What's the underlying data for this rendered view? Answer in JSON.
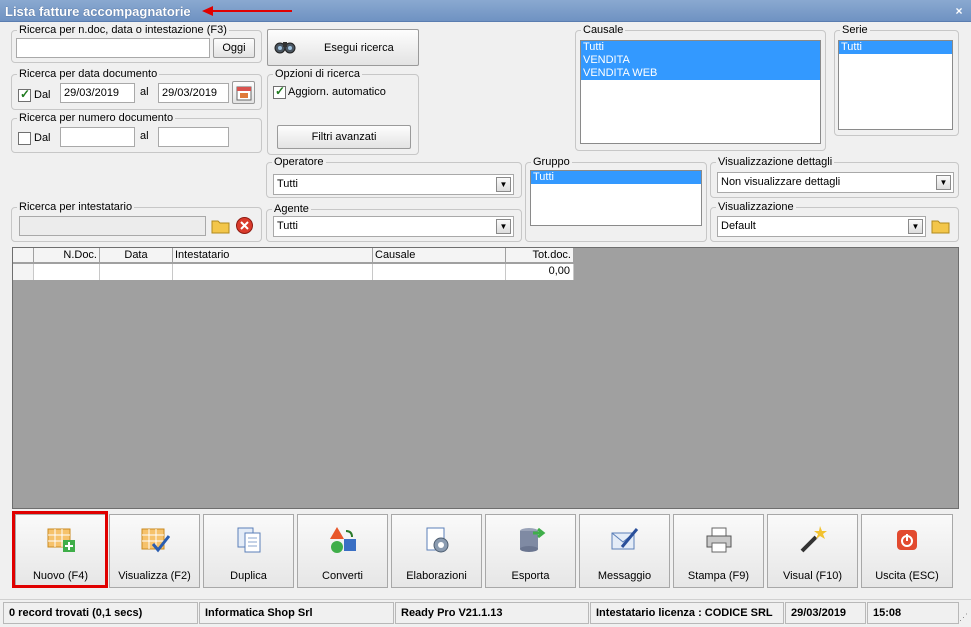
{
  "window": {
    "title": "Lista fatture accompagnatorie",
    "close": "×"
  },
  "search": {
    "legend": "Ricerca per n.doc, data o intestazione (F3)",
    "value": "",
    "today_button": "Oggi",
    "run_button": "Esegui ricerca"
  },
  "date_search": {
    "legend": "Ricerca per data documento",
    "from_label": "Dal",
    "from_checked": true,
    "from_value": "29/03/2019",
    "to_label": "al",
    "to_value": "29/03/2019"
  },
  "number_search": {
    "legend": "Ricerca per numero documento",
    "from_label": "Dal",
    "from_checked": false,
    "from_value": "",
    "to_label": "al",
    "to_value": ""
  },
  "options": {
    "legend": "Opzioni di ricerca",
    "auto_update_label": "Aggiorn. automatico",
    "auto_update_checked": true,
    "advanced_button": "Filtri avanzati"
  },
  "causale": {
    "legend": "Causale",
    "items": [
      "Tutti",
      "VENDITA",
      "VENDITA WEB"
    ]
  },
  "serie": {
    "legend": "Serie",
    "items": [
      "Tutti"
    ]
  },
  "operatore": {
    "legend": "Operatore",
    "value": "Tutti"
  },
  "agente": {
    "legend": "Agente",
    "value": "Tutti"
  },
  "gruppo": {
    "legend": "Gruppo",
    "items": [
      "Tutti"
    ]
  },
  "dettagli": {
    "legend": "Visualizzazione dettagli",
    "value": "Non visualizzare dettagli"
  },
  "visualizzazione": {
    "legend": "Visualizzazione",
    "value": "Default"
  },
  "intestatario": {
    "legend": "Ricerca per intestatario",
    "value": ""
  },
  "grid": {
    "columns": [
      "N.Doc.",
      "Data",
      "Intestatario",
      "Causale",
      "Tot.doc."
    ],
    "rows": [
      [
        "",
        "",
        "",
        "",
        "0,00"
      ]
    ]
  },
  "toolbar": {
    "buttons": [
      {
        "label": "Nuovo (F4)",
        "icon": "new-grid-icon"
      },
      {
        "label": "Visualizza (F2)",
        "icon": "view-grid-icon"
      },
      {
        "label": "Duplica",
        "icon": "duplicate-icon"
      },
      {
        "label": "Converti",
        "icon": "convert-icon"
      },
      {
        "label": "Elaborazioni",
        "icon": "process-icon"
      },
      {
        "label": "Esporta",
        "icon": "export-icon"
      },
      {
        "label": "Messaggio",
        "icon": "message-icon"
      },
      {
        "label": "Stampa (F9)",
        "icon": "printer-icon"
      },
      {
        "label": "Visual (F10)",
        "icon": "magic-wand-icon"
      },
      {
        "label": "Uscita (ESC)",
        "icon": "exit-icon"
      }
    ]
  },
  "status": {
    "records": "0 record trovati (0,1 secs)",
    "company": "Informatica Shop Srl",
    "version": "Ready Pro V21.1.13",
    "license": "Intestatario licenza : CODICE SRL",
    "date": "29/03/2019",
    "time": "15:08"
  },
  "colors": {
    "title_bar": "#7b9cc8",
    "selection": "#3399ff",
    "highlight": "#e00000",
    "grid_background": "#a0a0a0"
  }
}
